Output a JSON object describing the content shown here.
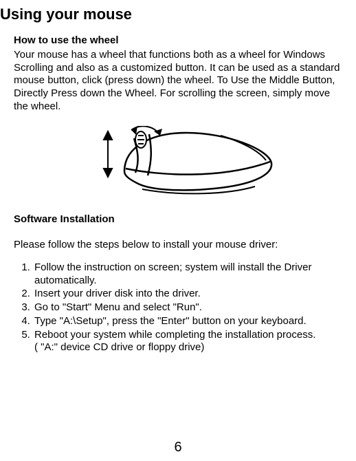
{
  "title": "Using your mouse",
  "section1": {
    "heading": "How to use the wheel",
    "body": "Your mouse has a wheel that functions both as a wheel for Windows Scrolling and also as a customized button. It can be used as a standard mouse button, click (press down) the wheel.    To Use the Middle Button, Directly Press down the Wheel.    For scrolling the screen, simply move the wheel."
  },
  "section2": {
    "heading": "Software Installation",
    "intro": "Please follow the steps below to install your mouse driver:",
    "steps": [
      "Follow the instruction on screen; system will install the Driver automatically.",
      "Insert your driver disk into the driver.",
      "Go to \"Start\" Menu and select \"Run\".",
      "Type \"A:\\Setup\", press the \"Enter\" button on your keyboard.",
      "Reboot your system while completing the installation process."
    ],
    "note": "( \"A:\" device CD drive or floppy drive)"
  },
  "pageNumber": "6"
}
